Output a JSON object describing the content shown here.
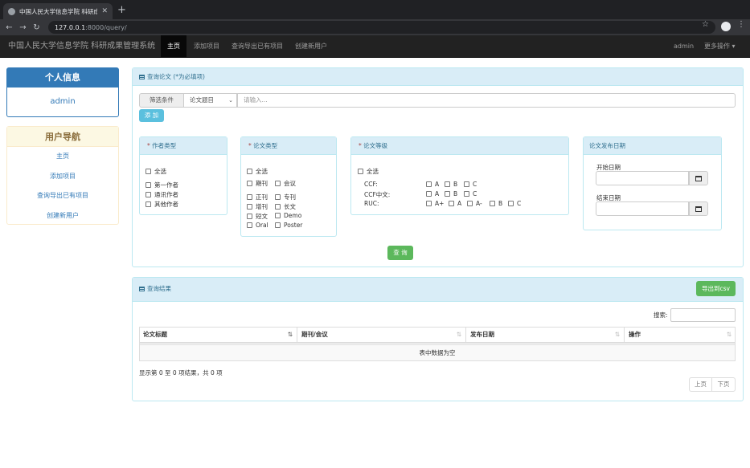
{
  "browser": {
    "tab_title": "中国人民大学信息学院 科研成果",
    "url_host": "127.0.0.1",
    "url_path": ":8000/query/"
  },
  "navbar": {
    "brand": "中国人民大学信息学院 科研成果管理系统",
    "links": [
      "主页",
      "添加项目",
      "查询导出已有项目",
      "创建新用户"
    ],
    "user": "admin",
    "more": "更多操作 ▾"
  },
  "sidebar": {
    "profile_title": "个人信息",
    "username": "admin",
    "nav_title": "用户导航",
    "nav_items": [
      "主页",
      "添加项目",
      "查询导出已有项目",
      "创建新用户"
    ]
  },
  "query": {
    "title": "查询论文 (*为必填项)",
    "filter_label": "筛选条件",
    "filter_select": "论文题目",
    "filter_placeholder": "请输入...",
    "add_button": "添 加",
    "author_type": {
      "title": "作者类型",
      "options": [
        "全选",
        "第一作者",
        "通讯作者",
        "其他作者"
      ]
    },
    "paper_type": {
      "title": "论文类型",
      "options": [
        "全选",
        "期刊",
        "会议",
        "正刊",
        "专刊",
        "增刊",
        "长文",
        "短文",
        "Demo",
        "Oral",
        "Poster"
      ]
    },
    "paper_level": {
      "title": "论文等级",
      "all": "全选",
      "rows": [
        {
          "label": "CCF:",
          "options": [
            "A",
            "B",
            "C"
          ]
        },
        {
          "label": "CCF中文:",
          "options": [
            "A",
            "B",
            "C"
          ]
        },
        {
          "label": "RUC:",
          "options": [
            "A+",
            "A",
            "A-",
            "B",
            "C"
          ]
        }
      ]
    },
    "date": {
      "title": "论文发布日期",
      "start_label": "开始日期",
      "end_label": "结束日期"
    },
    "query_button": "查 询"
  },
  "results": {
    "title": "查询结果",
    "export_button": "导出到csv",
    "search_label": "搜索:",
    "columns": [
      "论文标题",
      "期刊/会议",
      "发布日期",
      "操作"
    ],
    "empty_text": "表中数据为空",
    "info": "显示第 0 至 0 项结果，共 0 项",
    "prev": "上页",
    "next": "下页"
  }
}
